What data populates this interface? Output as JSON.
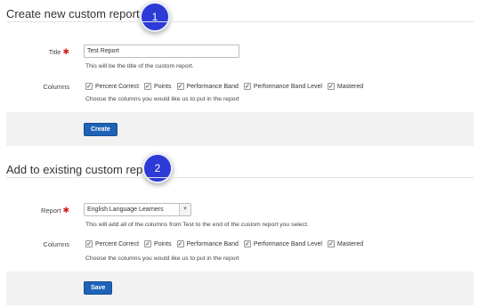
{
  "create": {
    "heading": "Create new custom report",
    "callout": "1",
    "title_label": "Title",
    "title_value": "Test Report",
    "title_hint": "This will be the title of the custom report.",
    "columns_label": "Columns",
    "columns": [
      "Percent Correct",
      "Points",
      "Performance Band",
      "Performance Band Level",
      "Mastered"
    ],
    "columns_hint": "Choose the columns you would like us to put in the report",
    "button": "Create"
  },
  "existing": {
    "heading": "Add to existing custom report",
    "callout": "2",
    "report_label": "Report",
    "report_value": "English Language Learners",
    "report_hint": "This will add all of the columns from Test to the end of the custom report you select.",
    "columns_label": "Columns",
    "columns": [
      "Percent Correct",
      "Points",
      "Performance Band",
      "Performance Band Level",
      "Mastered"
    ],
    "columns_hint": "Choose the columns you would like us to put in the report",
    "button": "Save"
  },
  "icons": {
    "required": "asterisk-icon",
    "checkbox": "checkmark-icon",
    "dropdown": "chevron-down-icon"
  },
  "colors": {
    "primary_button": "#1e63b7",
    "callout": "#2d3ad6",
    "required": "#d0211c"
  }
}
